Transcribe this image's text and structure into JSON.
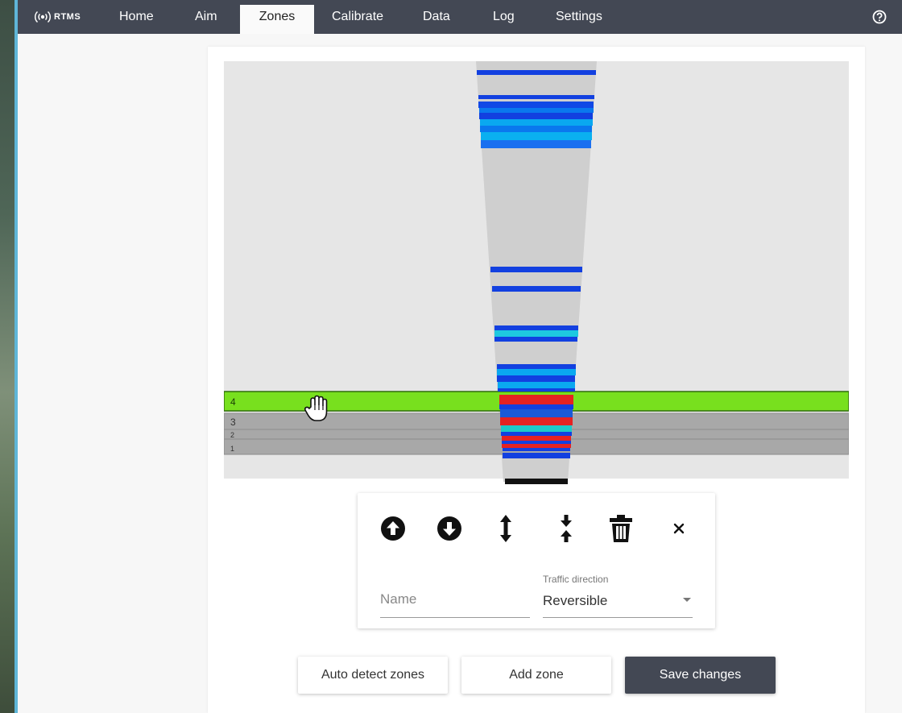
{
  "app": {
    "brand": "RTMS",
    "colors": {
      "nav_bg": "#434854",
      "accent_green": "#78e01e",
      "zone_gray": "#a8a8a8"
    }
  },
  "nav": {
    "items": [
      {
        "label": "Home",
        "active": false
      },
      {
        "label": "Aim",
        "active": false
      },
      {
        "label": "Zones",
        "active": true
      },
      {
        "label": "Calibrate",
        "active": false
      },
      {
        "label": "Data",
        "active": false
      },
      {
        "label": "Log",
        "active": false
      },
      {
        "label": "Settings",
        "active": false
      }
    ],
    "help_icon": "help-circle-icon"
  },
  "zones": {
    "items": [
      {
        "label": "4",
        "selected": true,
        "color": "#78e01e"
      },
      {
        "label": "3",
        "selected": false,
        "color": "#a8a8a8"
      },
      {
        "label": "2",
        "selected": false,
        "color": "#a8a8a8"
      },
      {
        "label": "1",
        "selected": false,
        "color": "#a8a8a8"
      }
    ]
  },
  "zone_editor": {
    "tools": [
      {
        "icon": "arrow-up-circle-icon"
      },
      {
        "icon": "arrow-down-circle-icon"
      },
      {
        "icon": "expand-vertical-icon"
      },
      {
        "icon": "compress-vertical-icon"
      },
      {
        "icon": "trash-icon"
      },
      {
        "icon": "close-icon"
      }
    ],
    "name_placeholder": "Name",
    "name_value": "",
    "direction_label": "Traffic direction",
    "direction_value": "Reversible"
  },
  "actions": {
    "auto_detect": "Auto detect zones",
    "add_zone": "Add zone",
    "save": "Save changes"
  }
}
